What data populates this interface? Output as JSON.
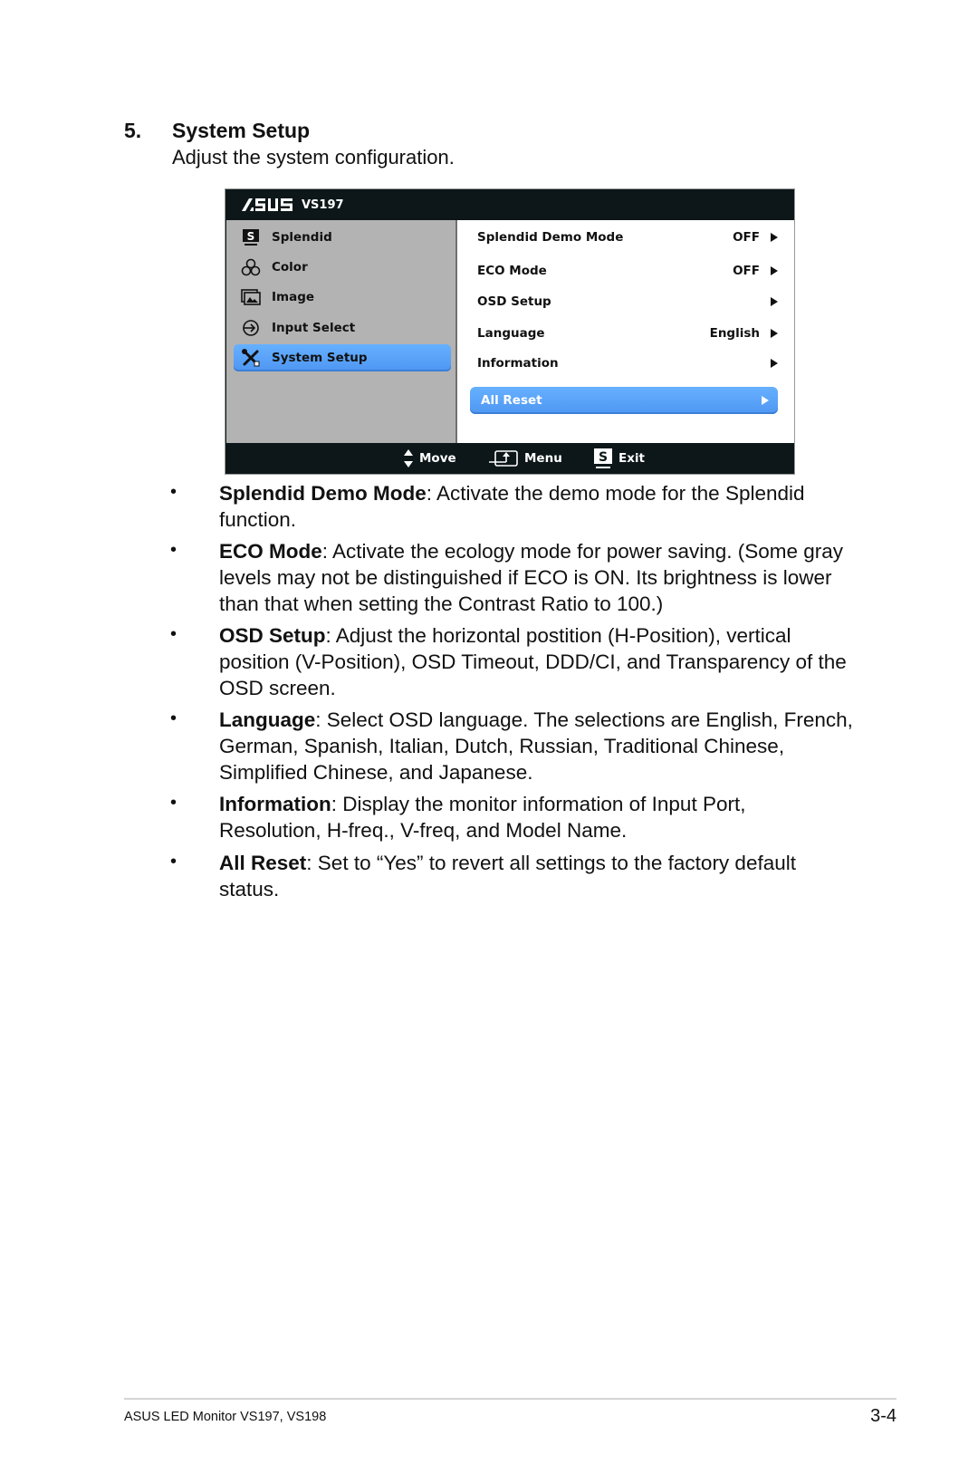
{
  "section": {
    "number": "5.",
    "title": "System Setup",
    "subtitle": "Adjust the system configuration."
  },
  "osd": {
    "brand": "/ISUS",
    "model": "VS197",
    "menu_items": [
      {
        "label": "Splendid",
        "icon": "splendid-s-icon",
        "active": false
      },
      {
        "label": "Color",
        "icon": "color-rgb-icon",
        "active": false
      },
      {
        "label": "Image",
        "icon": "image-icon",
        "active": false
      },
      {
        "label": "Input Select",
        "icon": "input-select-icon",
        "active": false
      },
      {
        "label": "System Setup",
        "icon": "wrench-screwdriver-icon",
        "active": true
      }
    ],
    "settings": [
      {
        "name": "Splendid Demo Mode",
        "value": "OFF"
      },
      {
        "name": "ECO Mode",
        "value": "OFF"
      },
      {
        "name": "OSD Setup",
        "value": ""
      },
      {
        "name": "Language",
        "value": "English"
      },
      {
        "name": "Information",
        "value": ""
      }
    ],
    "reset_label": "All Reset",
    "footer": {
      "move": "Move",
      "menu": "Menu",
      "exit": "Exit",
      "exit_key": "S"
    },
    "colors": {
      "header_bg": "#0d1719",
      "left_panel_bg": "#b3b3b3",
      "highlight": "#5aa3fa"
    }
  },
  "bullets": [
    {
      "term": "Splendid Demo Mode",
      "text": ": Activate the demo mode for the Splendid function."
    },
    {
      "term": "ECO Mode",
      "text": ": Activate the ecology mode for power saving. (Some gray levels may not be distinguished if ECO is ON. Its brightness is lower than that when setting the Contrast Ratio to 100.)"
    },
    {
      "term": "OSD Setup",
      "text": ": Adjust the horizontal postition (H-Position), vertical position (V-Position), OSD Timeout, DDD/CI, and Transparency of the OSD screen."
    },
    {
      "term": "Language",
      "text": ": Select OSD language. The selections are English, French, German, Spanish, Italian, Dutch, Russian, Traditional Chinese, Simplified Chinese, and Japanese."
    },
    {
      "term": "Information",
      "text": ": Display the monitor information of Input Port, Resolution, H-freq., V-freq, and Model Name."
    },
    {
      "term": "All Reset",
      "text": ": Set to “Yes” to revert all settings to the factory default status."
    }
  ],
  "footer": {
    "product": "ASUS LED Monitor VS197, VS198",
    "page": "3-4"
  }
}
